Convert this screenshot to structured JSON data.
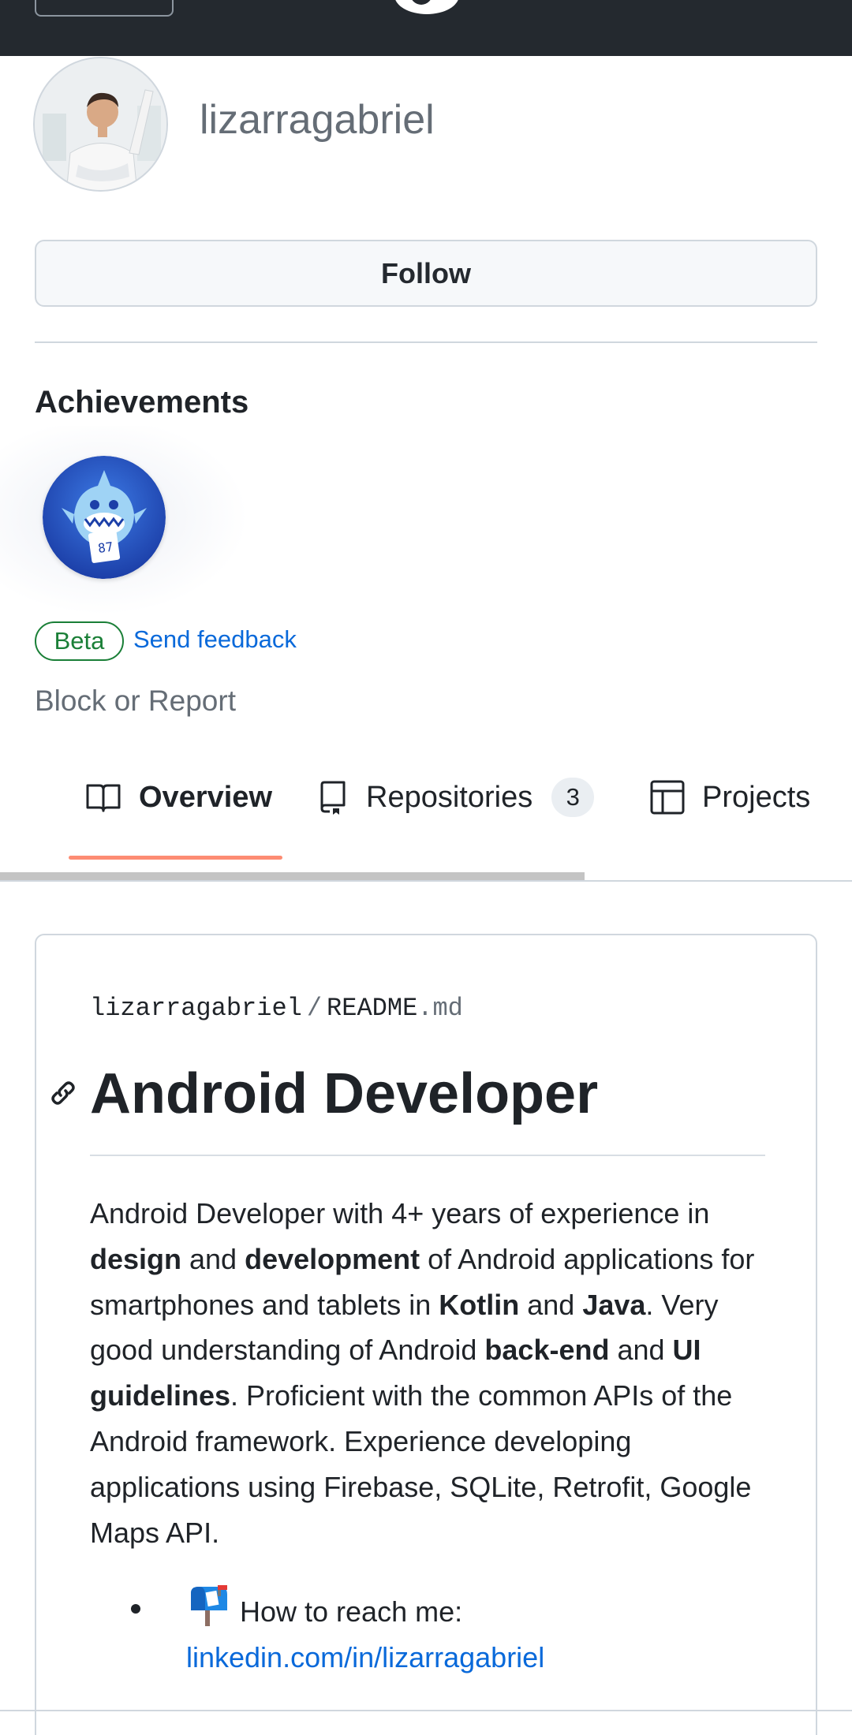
{
  "profile": {
    "username": "lizarragabriel",
    "follow_label": "Follow"
  },
  "achievements": {
    "title": "Achievements",
    "beta_label": "Beta",
    "feedback_label": "Send feedback"
  },
  "block_report_label": "Block or Report",
  "tabs": [
    {
      "label": "Overview",
      "icon": "book-icon",
      "active": true
    },
    {
      "label": "Repositories",
      "icon": "repo-icon",
      "count": "3"
    },
    {
      "label": "Projects",
      "icon": "table-icon"
    }
  ],
  "readme": {
    "owner": "lizarragabriel",
    "separator": "/",
    "file_base": "README",
    "file_ext": ".md",
    "heading": "Android Developer",
    "p": {
      "s1": "Android Developer with 4+ years of experience in ",
      "b1": "design",
      "s2": " and ",
      "b2": "development",
      "s3": " of Android applications for smartphones and tablets in ",
      "b3": "Kotlin",
      "s4": " and ",
      "b4": "Java",
      "s5": ". Very good understanding of Android ",
      "b5": "back-end",
      "s6": " and ",
      "b6": "UI guidelines",
      "s7": ". Proficient with the common APIs of the Android framework. Experience developing applications using Firebase, SQLite, Retrofit, Google Maps API."
    },
    "reach_label": "How to reach me:",
    "reach_link": "linkedin.com/in/lizarragabriel"
  },
  "colors": {
    "topbar": "#24292f",
    "link": "#0969da",
    "beta_green": "#1a7f37",
    "tab_underline": "#fd8c73"
  }
}
